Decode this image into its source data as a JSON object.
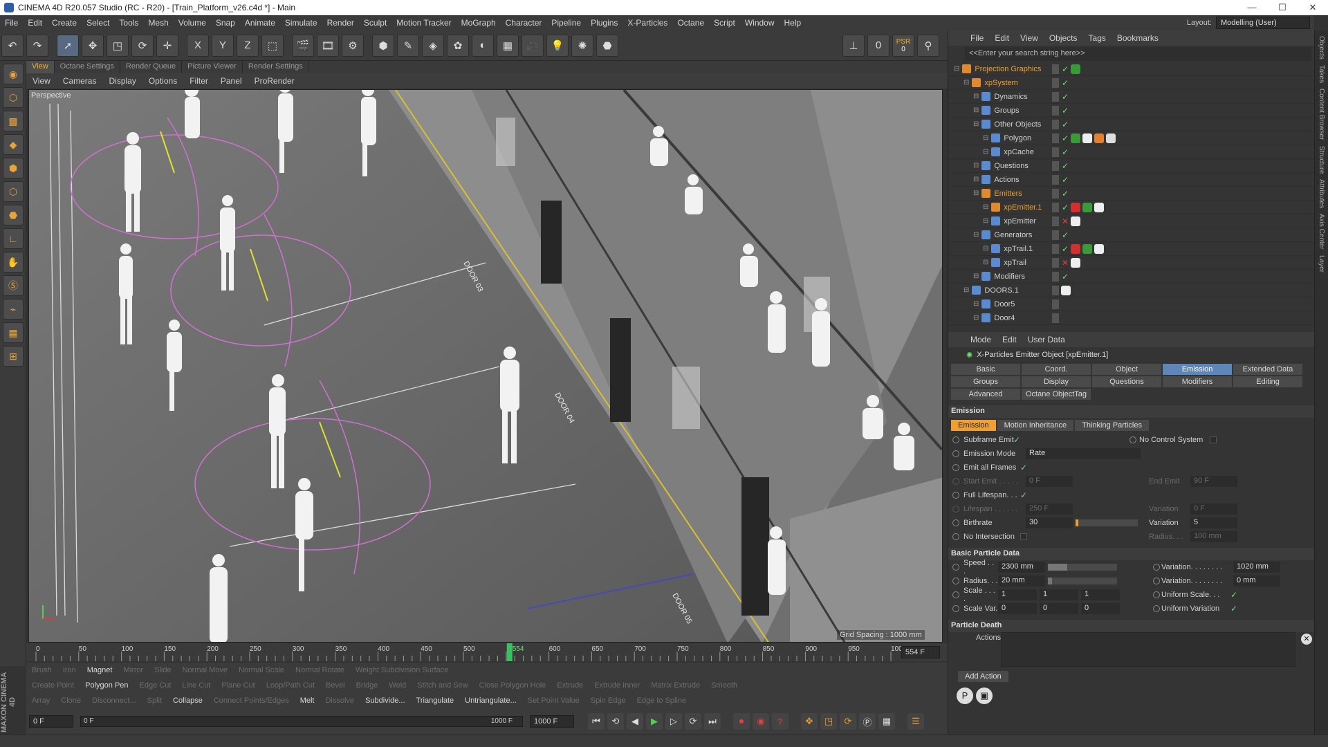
{
  "window": {
    "title": "CINEMA 4D R20.057 Studio (RC - R20) - [Train_Platform_v26.c4d *] - Main",
    "minimize": "—",
    "maximize": "☐",
    "close": "✕"
  },
  "menubar": [
    "File",
    "Edit",
    "Create",
    "Select",
    "Tools",
    "Mesh",
    "Volume",
    "Snap",
    "Animate",
    "Simulate",
    "Render",
    "Sculpt",
    "Motion Tracker",
    "MoGraph",
    "Character",
    "Pipeline",
    "Plugins",
    "X-Particles",
    "Octane",
    "Script",
    "Window",
    "Help"
  ],
  "layout": {
    "label": "Layout:",
    "value": "Modelling (User)"
  },
  "toolbar": {
    "x": "X",
    "y": "Y",
    "z": "Z",
    "psr": "PSR",
    "psr_value": "0",
    "zero": "0"
  },
  "viewport": {
    "tabs": [
      "View",
      "Octane Settings",
      "Render Queue",
      "Picture Viewer",
      "Render Settings"
    ],
    "menu": [
      "View",
      "Cameras",
      "Display",
      "Options",
      "Filter",
      "Panel",
      "ProRender"
    ],
    "label": "Perspective",
    "grid_spacing": "Grid Spacing : 1000 mm",
    "door_labels": [
      "DOOR 03",
      "DOOR 04",
      "DOOR 05"
    ]
  },
  "timeline": {
    "ticks": [
      "0",
      "50",
      "100",
      "150",
      "200",
      "250",
      "300",
      "350",
      "400",
      "450",
      "500",
      "554",
      "600",
      "650",
      "700",
      "750",
      "800",
      "850",
      "900",
      "950",
      "1000"
    ],
    "current": "554 F",
    "current_frame": 554,
    "max_frame": 1000
  },
  "snapbar": {
    "row1": [
      "Brush",
      "Iron",
      "Magnet",
      "Mirror",
      "Slide",
      "Normal Move",
      "Normal Scale",
      "Normal Rotate",
      "Weight Subdivision Surface"
    ],
    "row2": [
      "Create Point",
      "Polygon Pen",
      "Edge Cut",
      "Line Cut",
      "Plane Cut",
      "Loop/Path Cut",
      "Bevel",
      "Bridge",
      "Weld",
      "Stitch and Sew",
      "Close Polygon Hole",
      "Extrude",
      "Extrude Inner",
      "Matrix Extrude",
      "Smooth"
    ],
    "row3": [
      "Array",
      "Clone",
      "Disconnect...",
      "Split",
      "Collapse",
      "Connect Points/Edges",
      "Melt",
      "Dissolve",
      "Subdivide...",
      "Triangulate",
      "Untriangulate...",
      "Set Point Value",
      "Spin Edge",
      "Edge to Spline"
    ],
    "active": [
      "Magnet",
      "Polygon Pen",
      "Collapse",
      "Melt",
      "Subdivide...",
      "Triangulate",
      "Untriangulate..."
    ]
  },
  "transport": {
    "start": "0 F",
    "range_start": "0 F",
    "range_end": "1000 F",
    "end": "1000 F"
  },
  "brand": "MAXON CINEMA 4D",
  "objects": {
    "menu": [
      "File",
      "Edit",
      "View",
      "Objects",
      "Tags",
      "Bookmarks"
    ],
    "search_placeholder": "<<Enter your search string here>>",
    "rows": [
      {
        "name": "Projection Graphics",
        "indent": 0,
        "orange": true,
        "flags": "chk",
        "tags": [
          "#3a9a3a"
        ]
      },
      {
        "name": "xpSystem",
        "indent": 1,
        "orange": true,
        "flags": "chk",
        "tags": []
      },
      {
        "name": "Dynamics",
        "indent": 2,
        "orange": false,
        "flags": "chk",
        "tags": []
      },
      {
        "name": "Groups",
        "indent": 2,
        "orange": false,
        "flags": "chk",
        "tags": []
      },
      {
        "name": "Other Objects",
        "indent": 2,
        "orange": false,
        "flags": "chk",
        "tags": []
      },
      {
        "name": "Polygon",
        "indent": 3,
        "orange": false,
        "flags": "chk",
        "tags": [
          "#3a9a3a",
          "#eeeeee",
          "#e08030",
          "#dddddd"
        ]
      },
      {
        "name": "xpCache",
        "indent": 3,
        "orange": false,
        "flags": "chk",
        "tags": []
      },
      {
        "name": "Questions",
        "indent": 2,
        "orange": false,
        "flags": "chk",
        "tags": []
      },
      {
        "name": "Actions",
        "indent": 2,
        "orange": false,
        "flags": "chk",
        "tags": []
      },
      {
        "name": "Emitters",
        "indent": 2,
        "orange": true,
        "flags": "chk",
        "tags": []
      },
      {
        "name": "xpEmitter.1",
        "indent": 3,
        "orange": true,
        "flags": "chk",
        "tags": [
          "#d03030",
          "#3a9a3a",
          "#eeeeee"
        ]
      },
      {
        "name": "xpEmitter",
        "indent": 3,
        "orange": false,
        "flags": "crs",
        "tags": [
          "#eeeeee"
        ]
      },
      {
        "name": "Generators",
        "indent": 2,
        "orange": false,
        "flags": "chk",
        "tags": []
      },
      {
        "name": "xpTrail.1",
        "indent": 3,
        "orange": false,
        "flags": "chk",
        "tags": [
          "#d03030",
          "#3a9a3a",
          "#eeeeee"
        ]
      },
      {
        "name": "xpTrail",
        "indent": 3,
        "orange": false,
        "flags": "crs",
        "tags": [
          "#eeeeee"
        ]
      },
      {
        "name": "Modifiers",
        "indent": 2,
        "orange": false,
        "flags": "chk",
        "tags": []
      },
      {
        "name": "DOORS.1",
        "indent": 1,
        "orange": false,
        "flags": "",
        "tags": [
          "#eeeeee"
        ]
      },
      {
        "name": "Door5",
        "indent": 2,
        "orange": false,
        "flags": "",
        "tags": []
      },
      {
        "name": "Door4",
        "indent": 2,
        "orange": false,
        "flags": "",
        "tags": []
      }
    ]
  },
  "attributes": {
    "menu": [
      "Mode",
      "Edit",
      "User Data"
    ],
    "title": "X-Particles Emitter Object [xpEmitter.1]",
    "tabs": [
      "Basic",
      "Coord.",
      "Object",
      "Emission",
      "Extended Data",
      "Groups",
      "Display",
      "Questions",
      "Modifiers",
      "Editing",
      "Advanced",
      "Octane ObjectTag"
    ],
    "active_tab": "Emission",
    "section_emission": "Emission",
    "subtabs": [
      "Emission",
      "Motion Inheritance",
      "Thinking Particles"
    ],
    "subframe_emit": "Subframe Emit",
    "no_control": "No Control System",
    "emission_mode_label": "Emission Mode",
    "emission_mode": "Rate",
    "emit_all_frames": "Emit all Frames",
    "start_emit": "Start Emit . . . . .",
    "start_emit_val": "0 F",
    "end_emit": "End Emit",
    "end_emit_val": "90 F",
    "full_lifespan": "Full Lifespan. . .",
    "lifespan": "Lifespan . . . . . .",
    "lifespan_val": "250 F",
    "lifespan_var": "Variation",
    "lifespan_var_val": "0 F",
    "birthrate": "Birthrate",
    "birthrate_val": "30",
    "birthrate_var": "Variation",
    "birthrate_var_val": "5",
    "no_intersection": "No Intersection",
    "radius_label": "Radius. . .",
    "radius_dim_val": "100 mm",
    "section_basic": "Basic Particle Data",
    "speed": "Speed . . .",
    "speed_val": "2300 mm",
    "speed_var": "Variation. . . . . . . .",
    "speed_var_val": "1020 mm",
    "radius": "Radius. . .",
    "radius_val": "20 mm",
    "radius_var": "Variation. . . . . . . .",
    "radius_var_val": "0 mm",
    "scale": "Scale . . . .",
    "scale_vals": [
      "1",
      "1",
      "1"
    ],
    "uniform_scale": "Uniform Scale. . .",
    "scale_var": "Scale Var.",
    "scale_var_vals": [
      "0",
      "0",
      "0"
    ],
    "uniform_variation": "Uniform Variation",
    "section_death": "Particle Death",
    "actions": "Actions",
    "add_action": "Add Action"
  },
  "right_strip": [
    "Objects",
    "Takes",
    "Content Browser",
    "Structure",
    "Attributes",
    "Axis Center",
    "Layer"
  ]
}
